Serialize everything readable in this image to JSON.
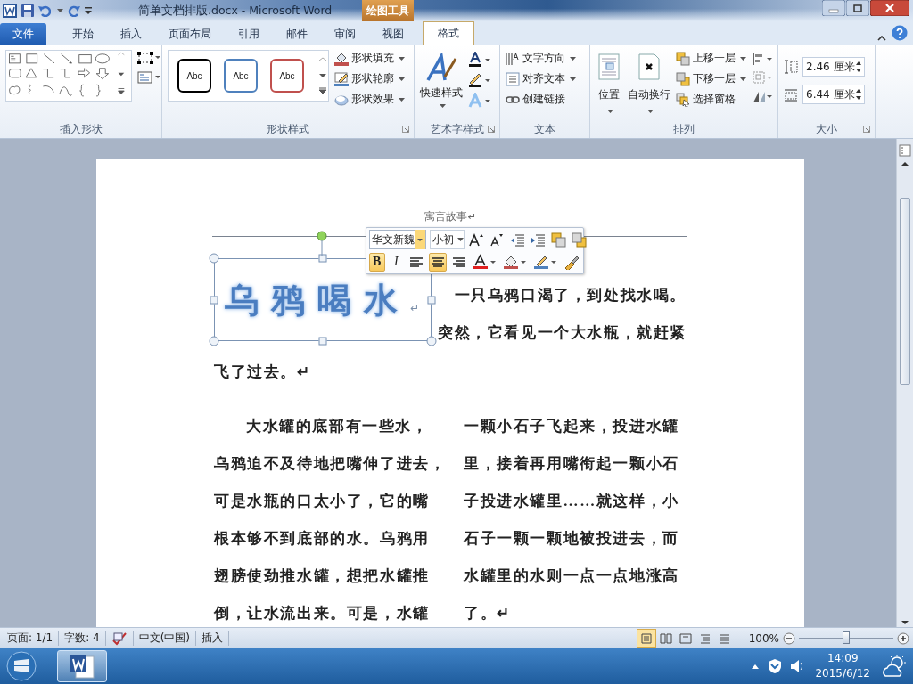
{
  "title_bar": {
    "title": "简单文档排版.docx  -  Microsoft Word",
    "contextual_tab": "绘图工具"
  },
  "tabs": [
    {
      "label": "文件",
      "kind": "file",
      "selected": false
    },
    {
      "label": "开始",
      "kind": "tab",
      "selected": false
    },
    {
      "label": "插入",
      "kind": "tab",
      "selected": false
    },
    {
      "label": "页面布局",
      "kind": "tab",
      "selected": false
    },
    {
      "label": "引用",
      "kind": "tab",
      "selected": false
    },
    {
      "label": "邮件",
      "kind": "tab",
      "selected": false
    },
    {
      "label": "审阅",
      "kind": "tab",
      "selected": false
    },
    {
      "label": "视图",
      "kind": "tab",
      "selected": false
    },
    {
      "label": "格式",
      "kind": "tab",
      "selected": true
    }
  ],
  "ribbon": {
    "groups": [
      {
        "label": "插入形状",
        "kind": "shapes",
        "launcher": false
      },
      {
        "label": "形状样式",
        "kind": "styles",
        "launcher": true,
        "styles": [
          {
            "text": "Abc",
            "color": "#000000"
          },
          {
            "text": "Abc",
            "color": "#4f81bd"
          },
          {
            "text": "Abc",
            "color": "#c0504d"
          }
        ],
        "commands": [
          "形状填充",
          "形状轮廓",
          "形状效果"
        ]
      },
      {
        "label": "艺术字样式",
        "kind": "wordart",
        "launcher": true,
        "button": "快速样式"
      },
      {
        "label": "文本",
        "kind": "text",
        "launcher": false,
        "commands": [
          "文字方向",
          "对齐文本",
          "创建链接"
        ]
      },
      {
        "label": "排列",
        "kind": "arrange",
        "launcher": false,
        "buttons": [
          "位置",
          "自动换行"
        ],
        "commands": [
          "上移一层",
          "下移一层",
          "选择窗格"
        ]
      },
      {
        "label": "大小",
        "kind": "size",
        "launcher": true,
        "fields": [
          "2.46 厘米",
          "6.44 厘米"
        ]
      }
    ]
  },
  "document": {
    "header": "寓言故事↵",
    "title_art": "乌鸦喝水",
    "title_mark": "↵",
    "intro_lines": [
      "一只乌鸦口渴了，到处找水喝。",
      "突然，它看见一个大水瓶，就赶紧"
    ],
    "intro_last": "飞了过去。↵",
    "left_column": [
      "大水罐的底部有一些水，",
      "乌鸦迫不及待地把嘴伸了进去，",
      "可是水瓶的口太小了，它的嘴",
      "根本够不到底部的水。乌鸦用",
      "翅膀使劲推水罐，想把水罐推",
      "倒，让水流出来。可是，水罐"
    ],
    "right_column": [
      "一颗小石子飞起来，投进水罐",
      "里，接着再用嘴衔起一颗小石",
      "子投进水罐里……就这样，小",
      "石子一颗一颗地被投进去，而",
      "水罐里的水则一点一点地涨高",
      "了。↵"
    ]
  },
  "mini_toolbar": {
    "font": "华文新魏",
    "size": "小初",
    "format_buttons": [
      {
        "text": "B",
        "kind": "bold",
        "selected": true
      },
      {
        "text": "I",
        "kind": "italic",
        "selected": false
      }
    ],
    "align_buttons": [
      {
        "kind": "left",
        "selected": false
      },
      {
        "kind": "center",
        "selected": true
      },
      {
        "kind": "right",
        "selected": false
      }
    ]
  },
  "status_bar": {
    "items": [
      {
        "text": "页面: 1/1",
        "kind": "text"
      },
      {
        "text": "字数: 4",
        "kind": "text"
      },
      {
        "kind": "proof"
      },
      {
        "text": "中文(中国)",
        "kind": "text"
      },
      {
        "text": "插入",
        "kind": "text"
      }
    ],
    "views": [
      {
        "selected": true
      },
      {
        "selected": false
      },
      {
        "selected": false
      },
      {
        "selected": false
      },
      {
        "selected": false
      }
    ],
    "zoom": "100%",
    "zoom_slider": {
      "level": 0.5
    }
  },
  "taskbar": {
    "apps": [
      {
        "selected": true
      }
    ],
    "time": "14:09",
    "date": "2015/6/12"
  }
}
